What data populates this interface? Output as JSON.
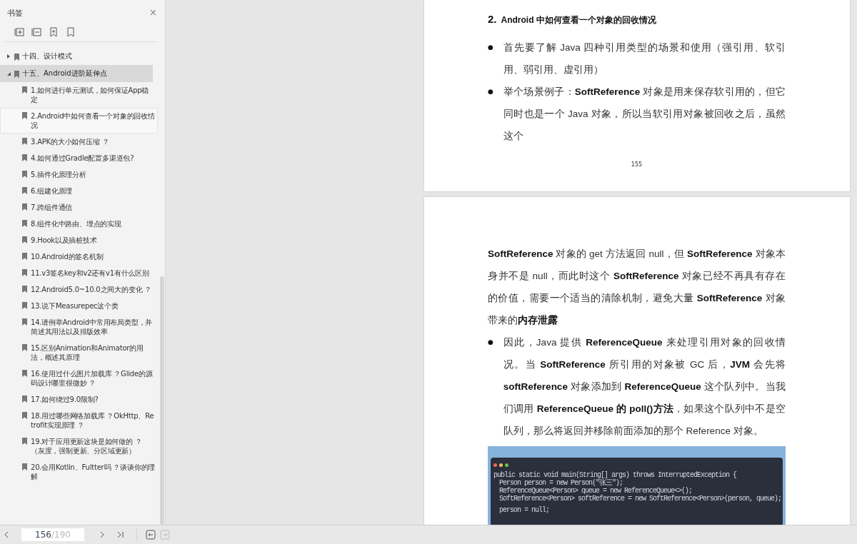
{
  "sidebar": {
    "title": "书签",
    "close": "×",
    "bookmarks": [
      {
        "label": "十四、设计模式",
        "expanded": false,
        "selected": false
      },
      {
        "label": "十五、Android进阶延伸点",
        "expanded": true,
        "selected": true,
        "children": [
          {
            "label": "1.如何进行单元测试，如何保证App稳定",
            "focused": false
          },
          {
            "label": "2.Android中如何查看一个对象的回收情况",
            "focused": true
          },
          {
            "label": "3.APK的大小如何压缩 ？",
            "focused": false
          },
          {
            "label": "4.如何通过Gradle配置多渠道包?",
            "focused": false
          },
          {
            "label": "5.插件化原理分析",
            "focused": false
          },
          {
            "label": "6.组建化原理",
            "focused": false
          },
          {
            "label": "7.跨组件通信",
            "focused": false
          },
          {
            "label": "8.组件化中路由、埋点的实现",
            "focused": false
          },
          {
            "label": "9.Hook以及插桩技术",
            "focused": false
          },
          {
            "label": "10.Android的签名机制",
            "focused": false
          },
          {
            "label": "11.v3签名key和v2还有v1有什么区别",
            "focused": false
          },
          {
            "label": "12.Android5.0~10.0之间大的变化 ？",
            "focused": false
          },
          {
            "label": "13.说下Measurepec这个类",
            "focused": false
          },
          {
            "label": "14.请例举Android中常用布局类型，并简述其用法以及排版效率",
            "focused": false
          },
          {
            "label": "15.区别Animation和Animator的用法，概述其原理",
            "focused": false
          },
          {
            "label": "16.使用过什么图片加载库 ？Glide的源码设计哪里很微妙 ？",
            "focused": false
          },
          {
            "label": "17.如何绕过9.0限制?",
            "focused": false
          },
          {
            "label": "18.用过哪些网络加载库 ？OkHttp、Retrofit实现原理 ？",
            "focused": false
          },
          {
            "label": "19.对于应用更新这块是如何做的 ？（灰度，强制更新、分区域更新）",
            "focused": false
          },
          {
            "label": "20.会用Kotlin、Fultter吗 ？谈谈你的理解",
            "focused": false
          }
        ]
      }
    ]
  },
  "pages": [
    {
      "heading_number": "2.",
      "heading": "Android 中如何查看一个对象的回收情况",
      "paragraphs": [
        {
          "bullet": "●",
          "text": "首先要了解 Java 四种引用类型的场景和使用（强引用、软引用、弱引用、虚引用）"
        },
        {
          "bullet": "●",
          "text": "举个场景例子：**SoftReference** 对象是用来保存软引用的，但它同时也是一个 Java 对象，所以当软引用对象被回收之后，虽然这个"
        }
      ],
      "page_number": "155"
    },
    {
      "paragraphs": [
        {
          "text": "**SoftReference** 对象的 get 方法返回 null，但 **SoftReference** 对象本身并不是 null，而此时这个 **SoftReference** 对象已经不再具有存在的价值，需要一个适当的清除机制，避免大量 **SoftReference** 对象带来的**内存泄露**"
        },
        {
          "bullet": "●",
          "text": "因此，Java 提供 **ReferenceQueue** 来处理引用对象的回收情况。当 **SoftReference** 所引用的对象被 GC 后，**JVM** 会先将 **softReference** 对象添加到 **ReferenceQueue** 这个队列中。当我们调用 **ReferenceQueue 的 poll()方法**，如果这个队列中不是空队列，那么将返回并移除前面添加的那个 Reference 对象。"
        }
      ],
      "code_window": {
        "lines": [
          {
            "text": "public static void main(String[] args) throws InterruptedException {",
            "indent": false,
            "gap_before": false
          },
          {
            "text": "Person person = new Person(\"张三\");",
            "indent": true,
            "gap_before": false
          },
          {
            "text": "ReferenceQueue<Person> queue = new ReferenceQueue<>();",
            "indent": true,
            "gap_before": false
          },
          {
            "text": "SoftReference<Person> softReference = new SoftReference<Person>(person, queue);",
            "indent": true,
            "gap_before": false
          },
          {
            "text": "person = null;",
            "indent": true,
            "gap_before": true
          }
        ]
      }
    }
  ],
  "footer": {
    "current_page": "156",
    "total_pages": "/190"
  }
}
